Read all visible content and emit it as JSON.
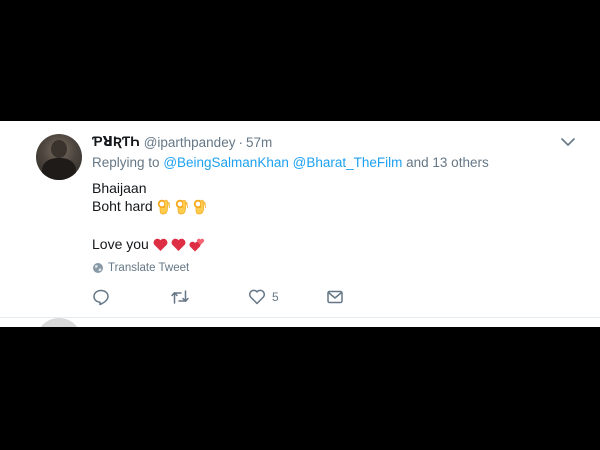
{
  "tweet": {
    "display_name": "ƤꓤƦƬҺ",
    "handle": "@iparthpandey",
    "separator": "·",
    "time": "57m",
    "reply": {
      "prefix": "Replying to",
      "mention_1": "@BeingSalmanKhan",
      "mention_2": "@Bharat_TheFilm",
      "suffix": "and 13 others"
    },
    "lines": {
      "line_1": "Bhaijaan",
      "line_2": "Boht hard",
      "line_3": "Love you"
    },
    "translate_label": "Translate Tweet",
    "actions": {
      "like_count": "5"
    }
  },
  "icons": {
    "ok_hand": "ok-hand-emoji",
    "heart": "red-heart-emoji",
    "two_hearts": "two-hearts-emoji",
    "globe": "globe-icon",
    "reply": "reply-icon",
    "retweet": "retweet-icon",
    "like": "heart-icon",
    "message": "message-icon",
    "caret": "chevron-down-icon"
  },
  "colors": {
    "link": "#1da1f2",
    "muted": "#657786",
    "text": "#14171a",
    "emoji_heart": "#dd2e44",
    "emoji_ok": "#ffcc4d"
  }
}
